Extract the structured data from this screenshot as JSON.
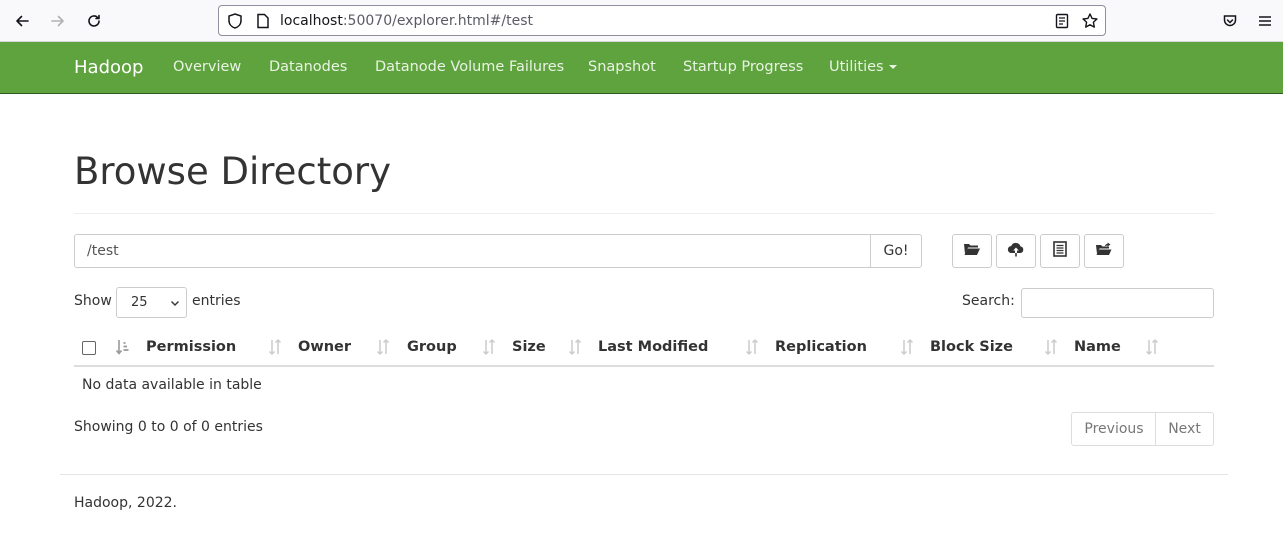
{
  "browser": {
    "url_host": "localhost",
    "url_rest": ":50070/explorer.html#/test"
  },
  "navbar": {
    "brand": "Hadoop",
    "links": [
      "Overview",
      "Datanodes",
      "Datanode Volume Failures",
      "Snapshot",
      "Startup Progress",
      "Utilities"
    ]
  },
  "page": {
    "title": "Browse Directory",
    "path_value": "/test",
    "go_label": "Go!"
  },
  "table_controls": {
    "show_label": "Show",
    "page_length": "25",
    "entries_label": "entries",
    "search_label": "Search:"
  },
  "table": {
    "columns": [
      "Permission",
      "Owner",
      "Group",
      "Size",
      "Last Modified",
      "Replication",
      "Block Size",
      "Name"
    ],
    "empty_message": "No data available in table",
    "info": "Showing 0 to 0 of 0 entries"
  },
  "pagination": {
    "previous": "Previous",
    "next": "Next"
  },
  "footer": {
    "text": "Hadoop, 2022."
  },
  "colors": {
    "navbar": "#5fa33f",
    "navbar_border": "#2f5a22"
  },
  "icons": {
    "toolbar": [
      "folder-open-icon",
      "cloud-upload-icon",
      "list-icon",
      "folder-share-icon"
    ]
  }
}
